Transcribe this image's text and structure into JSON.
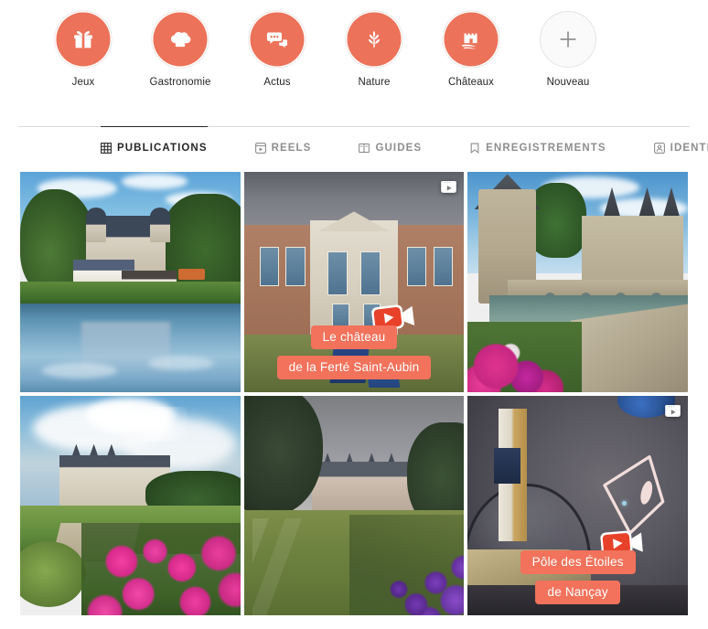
{
  "highlights": {
    "items": [
      {
        "label": "Jeux",
        "icon": "gift-icon",
        "type": "story"
      },
      {
        "label": "Gastronomie",
        "icon": "chef-hat-icon",
        "type": "story"
      },
      {
        "label": "Actus",
        "icon": "speech-bubbles-icon",
        "type": "story"
      },
      {
        "label": "Nature",
        "icon": "wheat-plant-icon",
        "type": "story"
      },
      {
        "label": "Châteaux",
        "icon": "castle-icon",
        "type": "story"
      },
      {
        "label": "Nouveau",
        "icon": "plus-icon",
        "type": "new"
      }
    ],
    "accent_color": "#EC7259"
  },
  "tabs": [
    {
      "label": "PUBLICATIONS",
      "icon": "grid-icon",
      "active": true
    },
    {
      "label": "REELS",
      "icon": "reels-icon",
      "active": false
    },
    {
      "label": "GUIDES",
      "icon": "guides-icon",
      "active": false
    },
    {
      "label": "ENREGISTREMENTS",
      "icon": "bookmark-icon",
      "active": false
    },
    {
      "label": "IDENTIFIÉ(E)",
      "icon": "person-tag-icon",
      "active": false
    }
  ],
  "grid": {
    "posts": [
      {
        "id": "post-1",
        "alt": "Château au bord de la rivière avec reflet",
        "is_video": false,
        "captions": []
      },
      {
        "id": "post-2",
        "alt": "Manoir en brique avec transats dans le jardin",
        "is_video": true,
        "captions": [
          "Le château",
          "de la Ferté Saint-Aubin"
        ]
      },
      {
        "id": "post-3",
        "alt": "Château de Sully-sur-Loire et ses douves fleuries",
        "is_video": false,
        "captions": []
      },
      {
        "id": "post-4",
        "alt": "Château et dahlias roses sous un ciel nuageux",
        "is_video": false,
        "captions": []
      },
      {
        "id": "post-5",
        "alt": "Château de Chaumont, allée engazonnée et fleurs violettes",
        "is_video": false,
        "captions": []
      },
      {
        "id": "post-6",
        "alt": "Intérieur du planétarium",
        "is_video": true,
        "captions": [
          "Pôle des Étoiles",
          "de Nançay"
        ]
      }
    ],
    "caption_chip_color": "#F2725B"
  }
}
